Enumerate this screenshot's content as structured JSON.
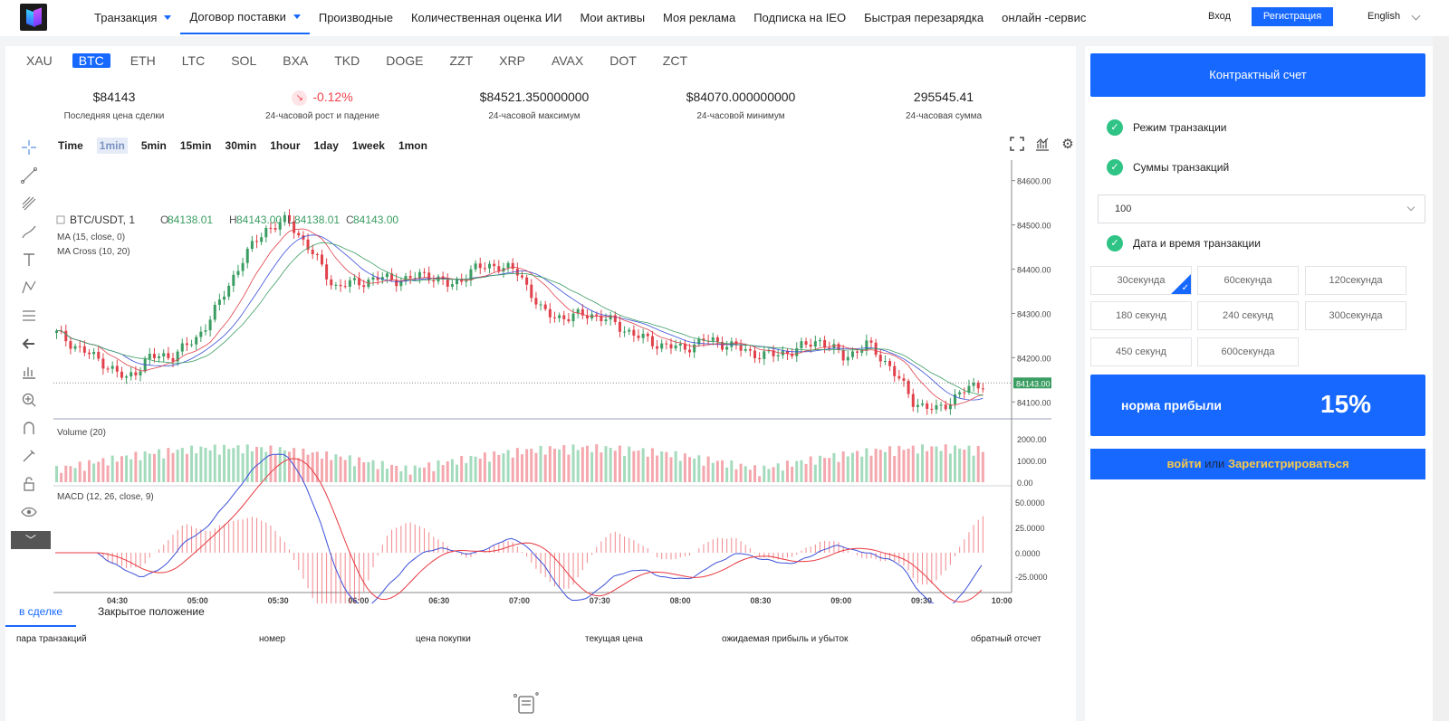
{
  "nav": {
    "items": [
      {
        "label": "Транзакция",
        "caret": true
      },
      {
        "label": "Договор поставки",
        "caret": true,
        "active": true
      },
      {
        "label": "Производные"
      },
      {
        "label": "Количественная оценка ИИ"
      },
      {
        "label": "Мои активы"
      },
      {
        "label": "Моя реклама"
      },
      {
        "label": "Подписка на IEO"
      },
      {
        "label": "Быстрая перезарядка"
      },
      {
        "label": "онлайн -сервис"
      }
    ],
    "login": "Вход",
    "register": "Регистрация",
    "language": "English"
  },
  "coins": [
    "XAU",
    "BTC",
    "ETH",
    "LTC",
    "SOL",
    "BXA",
    "TKD",
    "DOGE",
    "ZZT",
    "XRP",
    "AVAX",
    "DOT",
    "ZCT"
  ],
  "active_coin": "BTC",
  "stats": [
    {
      "value": "$84143",
      "label": "Последняя цена сделки"
    },
    {
      "value": "-0.12%",
      "label": "24-часовой рост и падение",
      "negative": true
    },
    {
      "value": "$84521.350000000",
      "label": "24-часовой максимум"
    },
    {
      "value": "$84070.000000000",
      "label": "24-часовой минимум"
    },
    {
      "value": "295545.41",
      "label": "24-часовая сумма"
    }
  ],
  "timeframes": [
    "Time",
    "1min",
    "5min",
    "15min",
    "30min",
    "1hour",
    "1day",
    "1week",
    "1mon"
  ],
  "active_timeframe": "1min",
  "chart": {
    "symbol": "BTC/USDT, 1",
    "ohlc": {
      "o": "84138.01",
      "h": "84143.00",
      "l": "84138.01",
      "c": "84143.00"
    },
    "indicators": [
      "MA (15, close, 0)",
      "MA Cross (10, 20)"
    ],
    "volume_label": "Volume (20)",
    "macd_label": "MACD (12, 26, close, 9)",
    "last_price_tag": "84143.00",
    "colors": {
      "up": "#3a9d62",
      "down": "#e0414a",
      "vol_up": "#a4dbbd",
      "vol_down": "#f4a8ae",
      "macd": "#3b4fd8",
      "signal": "#e8383f"
    }
  },
  "chart_data": {
    "type": "line",
    "x": [
      "04:30",
      "05:00",
      "05:30",
      "06:00",
      "06:30",
      "07:00",
      "07:30",
      "08:00",
      "08:30",
      "09:00",
      "09:30",
      "10:00"
    ],
    "price_ticks": [
      "84600.00",
      "84500.00",
      "84400.00",
      "84300.00",
      "84200.00",
      "84100.00"
    ],
    "volume_ticks": [
      "2000.00",
      "1000.00",
      "0.00"
    ],
    "macd_ticks": [
      "50.0000",
      "25.0000",
      "0.0000",
      "-25.0000"
    ],
    "price_path": [
      84255,
      84220,
      84190,
      84150,
      84200,
      84205,
      84240,
      84320,
      84420,
      84490,
      84510,
      84440,
      84360,
      84370,
      84380,
      84375,
      84390,
      84360,
      84400,
      84410,
      84390,
      84300,
      84290,
      84300,
      84280,
      84250,
      84230,
      84220,
      84240,
      84230,
      84210,
      84205,
      84220,
      84240,
      84200,
      84230,
      84180,
      84100,
      84080,
      84120,
      84143
    ],
    "ylim": [
      84070,
      84630
    ]
  },
  "tabs": [
    "в сделке",
    "Закрытое положение"
  ],
  "table_headers": [
    "пара транзакций",
    "номер",
    "цена покупки",
    "текущая цена",
    "ожидаемая прибыль и убыток",
    "обратный отсчет"
  ],
  "side": {
    "contract_account": "Контрактный счет",
    "mode": "Режим транзакции",
    "amounts": "Суммы транзакций",
    "amount_value": "100",
    "datetime": "Дата и время транзакции",
    "times": [
      "30секунда",
      "60секунда",
      "120секунда",
      "180 секунд",
      "240 секунд",
      "300секунда",
      "450 секунд",
      "600секунда"
    ],
    "selected_time": "30секунда",
    "rate_label": "норма прибыли",
    "rate_value": "15%",
    "login_word": "войти",
    "or_word": "или",
    "register_word": "Зарегистрироваться"
  }
}
